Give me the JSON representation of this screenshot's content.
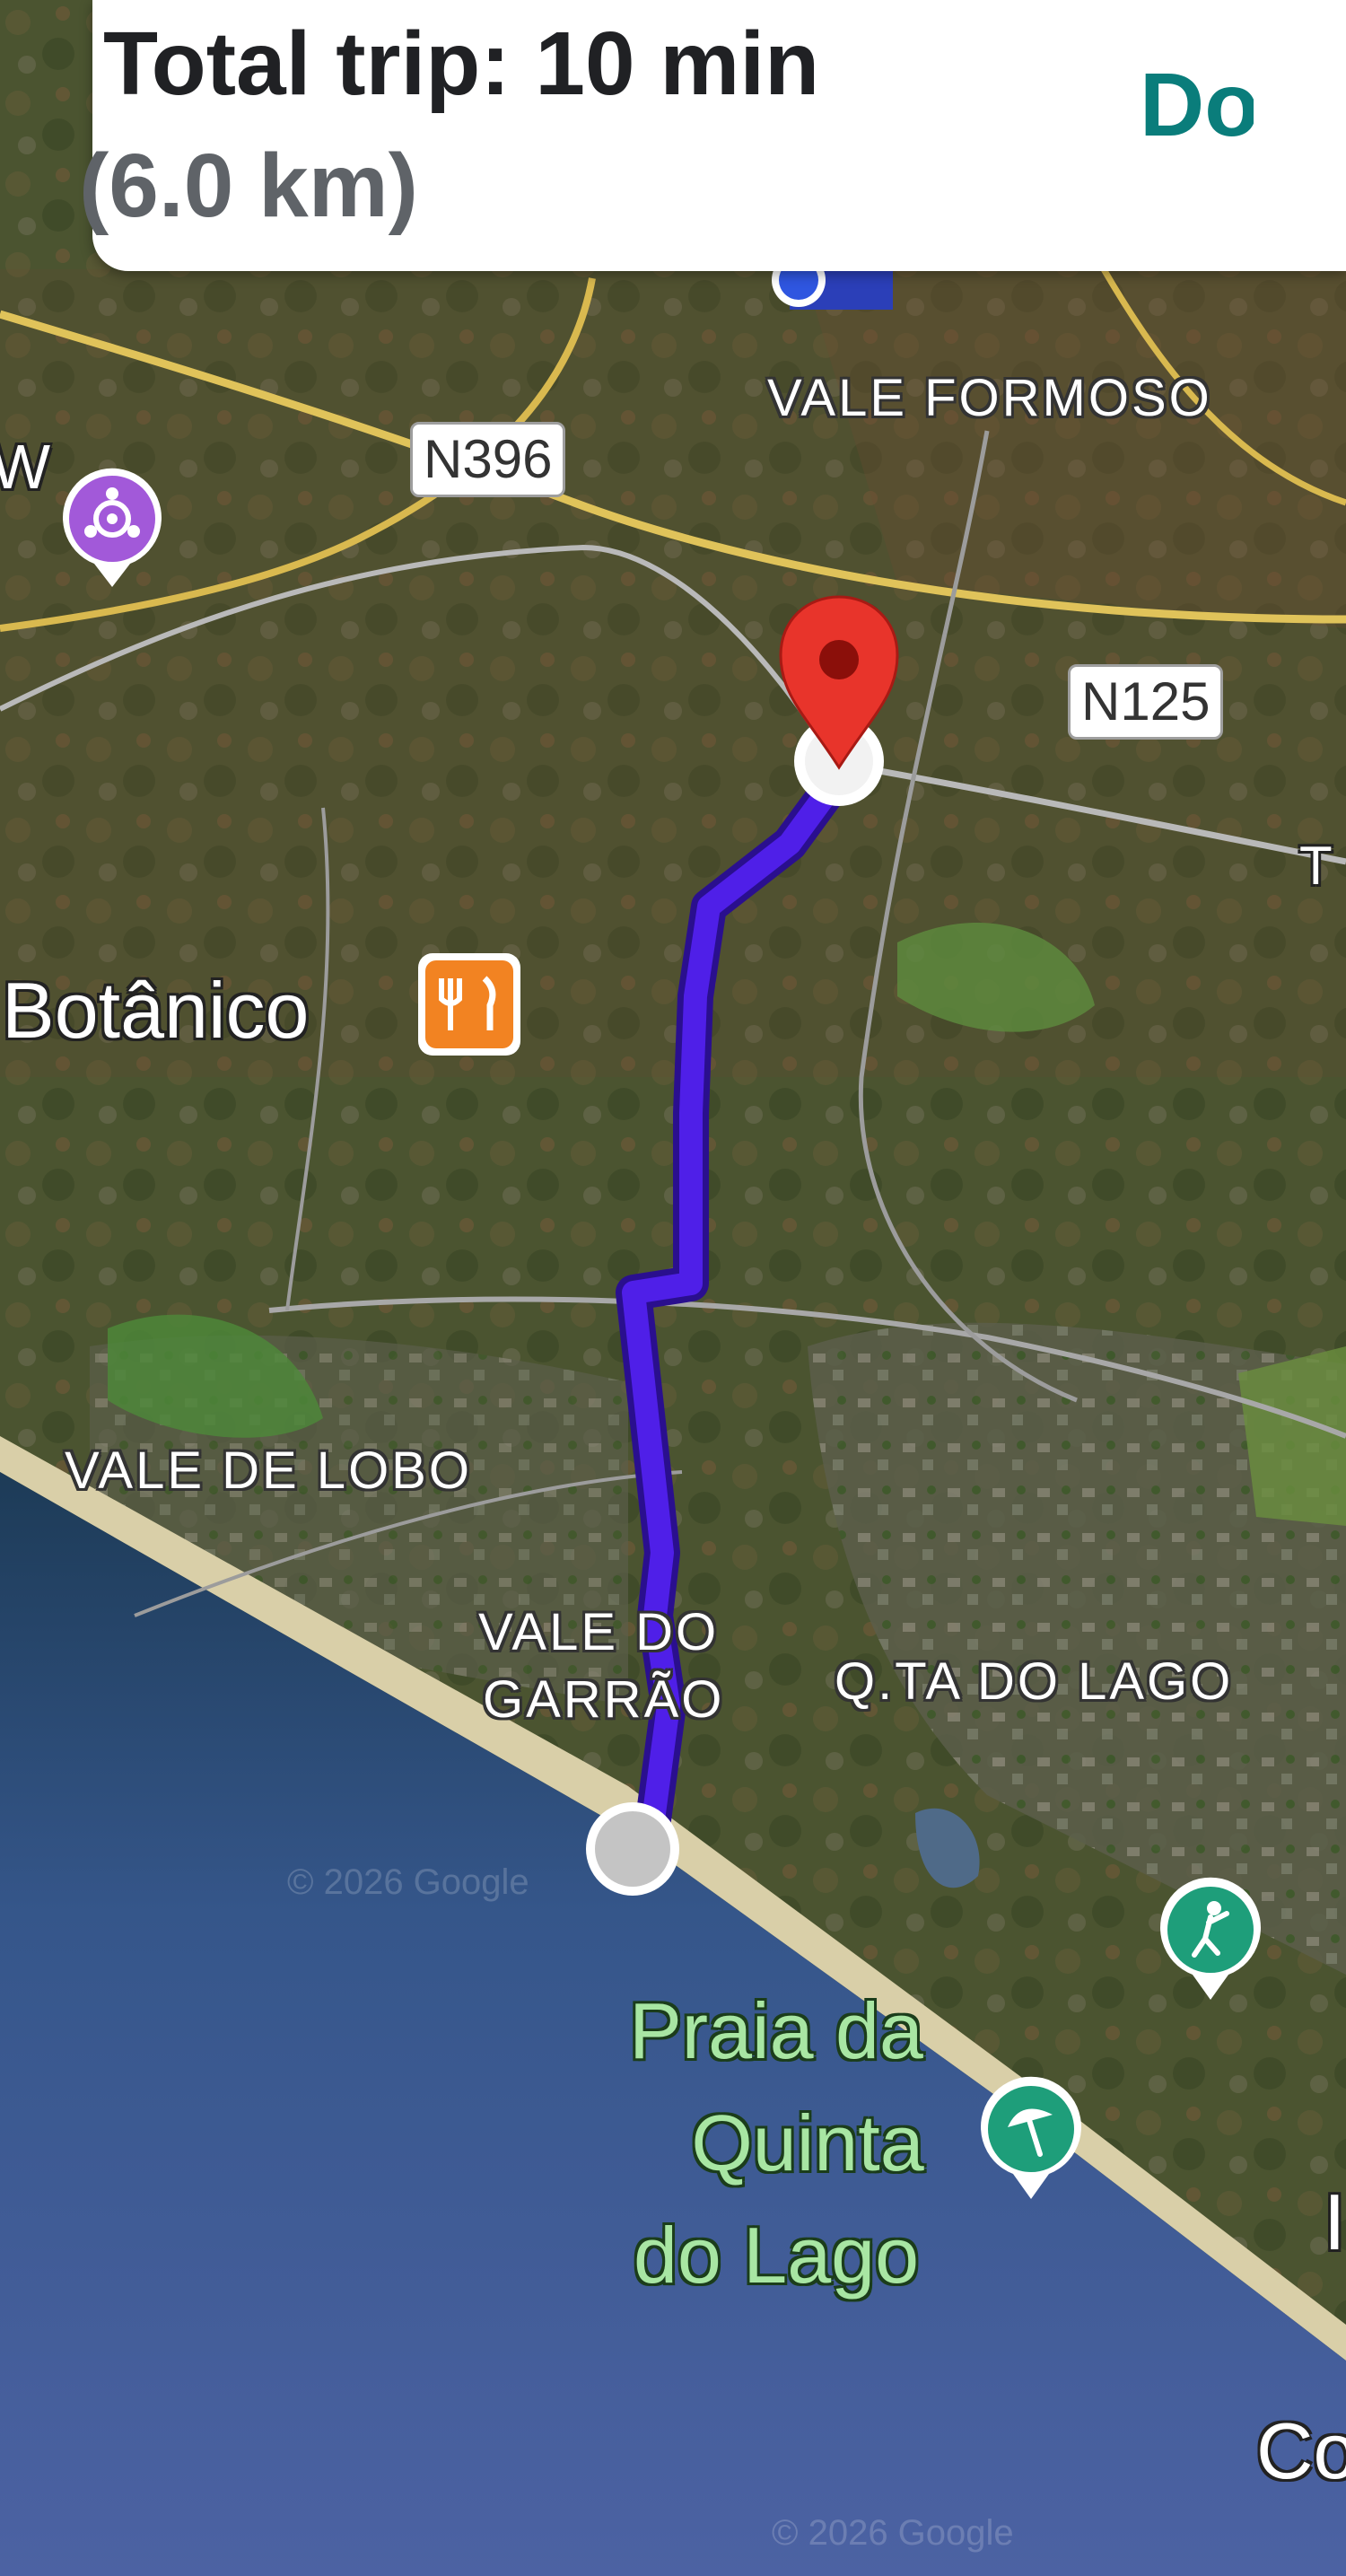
{
  "trip": {
    "total_label": "Total trip: 10 min",
    "distance_label": "(6.0 km)",
    "done_label": "Do"
  },
  "map": {
    "roads": [
      {
        "label": "N396"
      },
      {
        "label": "N125"
      }
    ],
    "areas": {
      "vale_formoso": "VALE FORMOSO",
      "vale_de_lobo": "VALE DE LOBO",
      "vale_do_garrao": "VALE DO GARRÃO",
      "vale_do_garrao_line1": "VALE DO",
      "vale_do_garrao_line2": "GARRÃO",
      "quinta_do_lago": "Q.TA DO LAGO"
    },
    "places": {
      "botanico": "Botânico",
      "beach_line1": "Praia da",
      "beach_line2": "Quinta",
      "beach_line3": "do Lago"
    },
    "edge_fragments": {
      "left_w": "W",
      "right_t": "T",
      "right_i": "I",
      "right_co": "Co"
    },
    "watermark": "© 2026 Google",
    "pois": [
      {
        "name": "attraction",
        "icon": "attraction-icon",
        "color": "#a259d9"
      },
      {
        "name": "restaurant",
        "icon": "restaurant-icon",
        "color": "#f28322"
      },
      {
        "name": "golf",
        "icon": "golf-icon",
        "color": "#1e9e7a"
      },
      {
        "name": "beach",
        "icon": "beach-umbrella-icon",
        "color": "#1e9e7a"
      }
    ],
    "route_color": "#4f1fe8",
    "destination_pin_color": "#e8342b"
  }
}
